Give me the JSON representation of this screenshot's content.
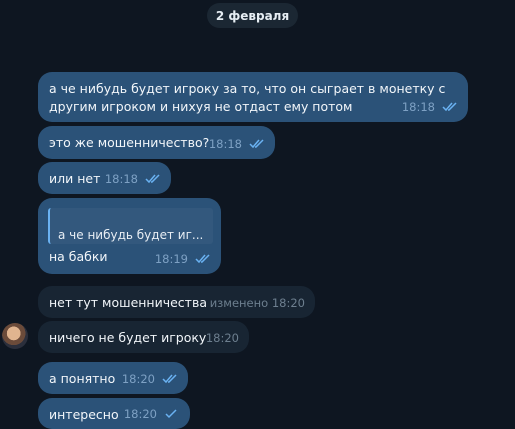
{
  "date_label": "2 февраля",
  "colors": {
    "background": "#0e1621",
    "outgoing_bubble": "#2b5278",
    "incoming_bubble": "#182533",
    "tick_color": "#6ab2f2"
  },
  "messages": [
    {
      "type": "out",
      "text": "а че нибудь будет игроку за то, что он сыграет в монетку с\nдругим игроком и нихуя не отдаст ему потом",
      "time": "18:18",
      "status": "read"
    },
    {
      "type": "out",
      "text": "это же мошенничество?",
      "time": "18:18",
      "status": "read"
    },
    {
      "type": "out",
      "text": "или нет",
      "time": "18:18",
      "status": "read"
    },
    {
      "type": "out",
      "reply_preview": "а че нибудь будет иг...",
      "text": "на бабки",
      "time": "18:19",
      "status": "read"
    },
    {
      "type": "in",
      "text": "нет тут мошенничества",
      "time": "изменено 18:20"
    },
    {
      "type": "in",
      "text": "ничего не будет игроку",
      "time": "18:20"
    },
    {
      "type": "out",
      "text": "а понятно",
      "time": "18:20",
      "status": "read"
    },
    {
      "type": "out",
      "text": "интересно",
      "time": "18:20",
      "status": "sent"
    }
  ]
}
